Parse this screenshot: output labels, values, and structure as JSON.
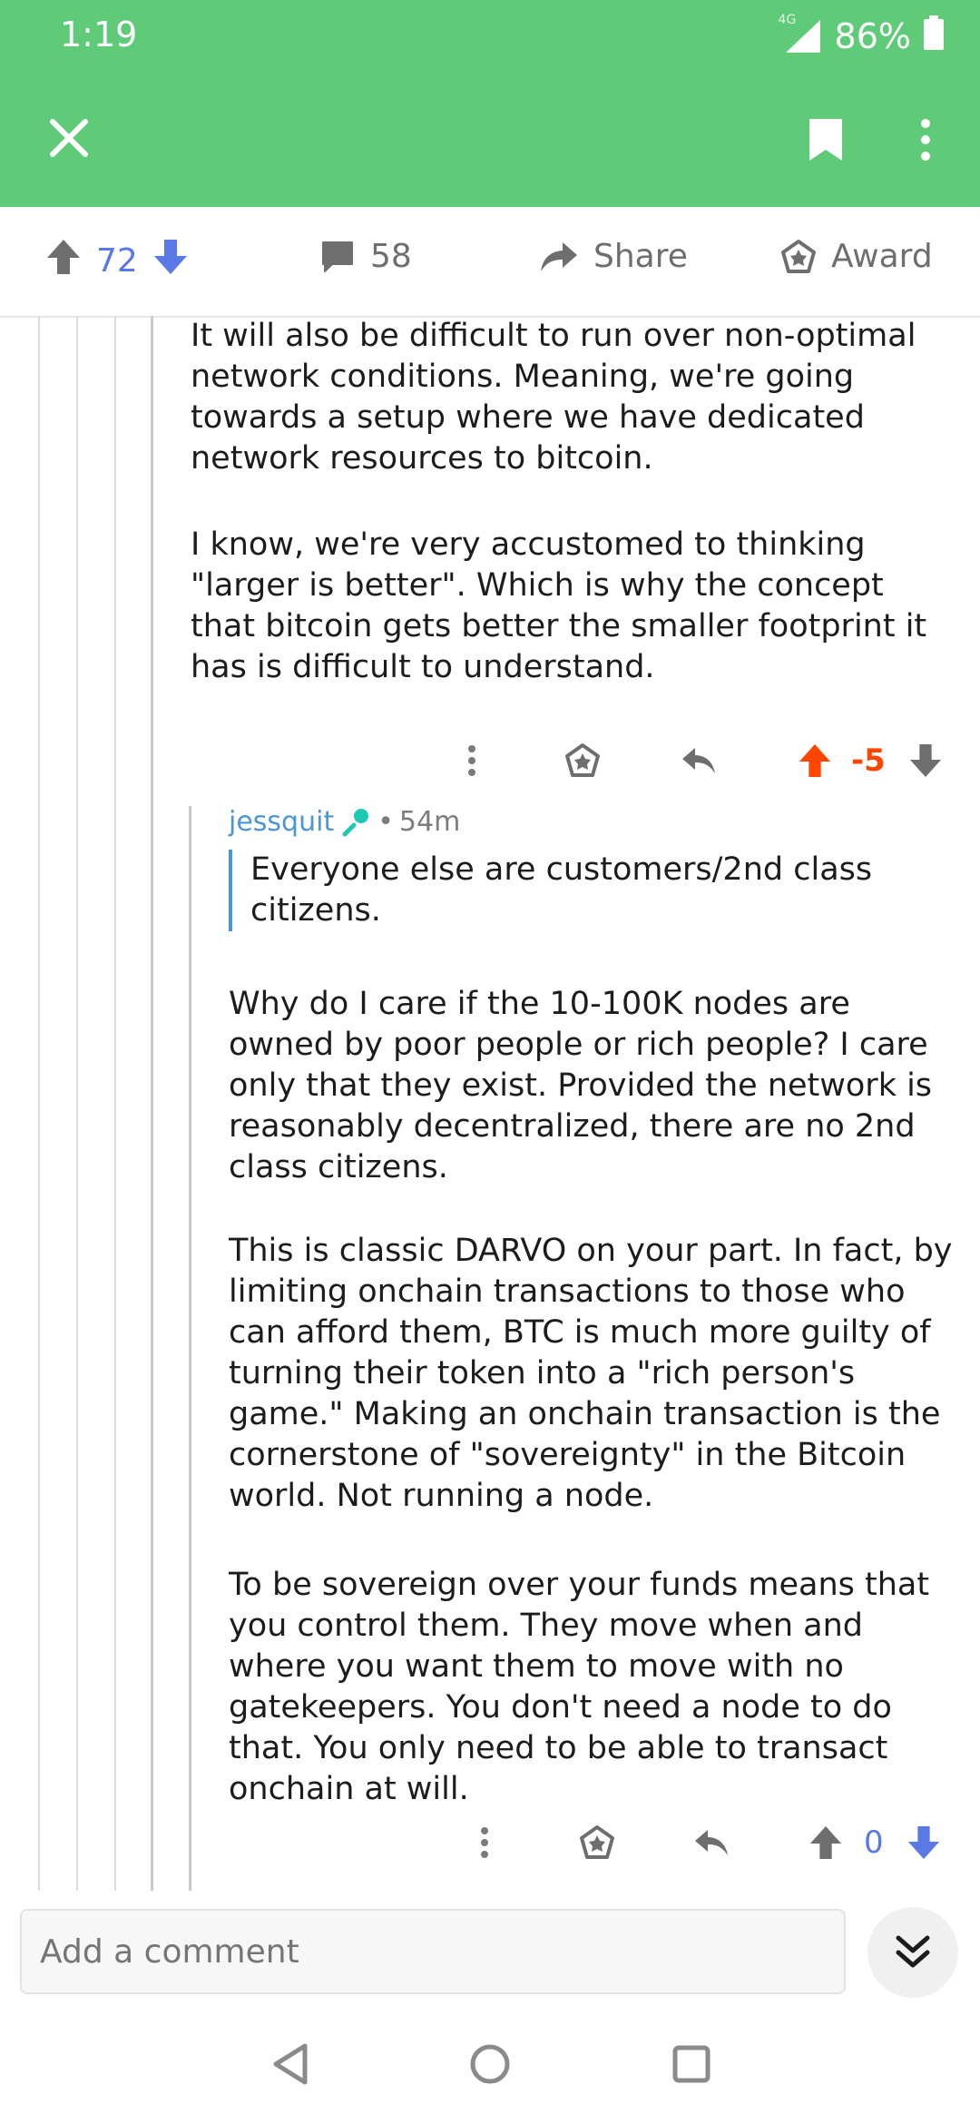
{
  "status": {
    "time": "1:19",
    "network": "4G",
    "battery": "86%"
  },
  "post_actions": {
    "upvotes": "72",
    "comments": "58",
    "share_label": "Share",
    "award_label": "Award"
  },
  "comment_parent": {
    "paragraphs": [
      "It will also be difficult to run over non-optimal network conditions. Meaning, we're going towards a setup where we have dedicated network resources to bitcoin.",
      "I know, we're very  accustomed to thinking \"larger is better\". Which is why the concept that bitcoin gets better the smaller footprint it has is difficult to understand."
    ],
    "score": "-5"
  },
  "comment_reply": {
    "author": "jessquit",
    "age": "54m",
    "quote": "Everyone else are customers/2nd class citizens.",
    "paragraphs": [
      "Why do I care if the 10-100K nodes are owned by poor people or rich people?  I care only that they exist.  Provided the network is reasonably decentralized, there are no 2nd class citizens.",
      "This is classic DARVO on your part.  In fact, by limiting onchain transactions to those who can afford them, BTC is much more guilty of turning their token into a \"rich person's game.\"  Making an onchain transaction is the cornerstone of \"sovereignty\" in the Bitcoin world.  Not running a node.",
      "To be sovereign over your funds means that you control them.  They move when and where you want them to move with no gatekeepers.  You don't need a node to do that.  You only need to be able to transact onchain at will."
    ],
    "score": "0"
  },
  "composer": {
    "placeholder": "Add a comment"
  },
  "icons": {
    "close": "close-icon",
    "bookmark": "bookmark-icon",
    "more": "more-vertical-icon",
    "upvote": "arrow-up-icon",
    "downvote": "arrow-down-icon",
    "comment": "comment-icon",
    "share": "share-icon",
    "award": "award-icon",
    "reply": "reply-icon",
    "mod": "microphone-icon",
    "collapse": "double-chevron-down-icon"
  },
  "colors": {
    "brand_green": "#5fca78",
    "upvote_orange": "#ff4500",
    "vote_blue": "#5a78e6",
    "link_blue": "#4a96d8"
  }
}
